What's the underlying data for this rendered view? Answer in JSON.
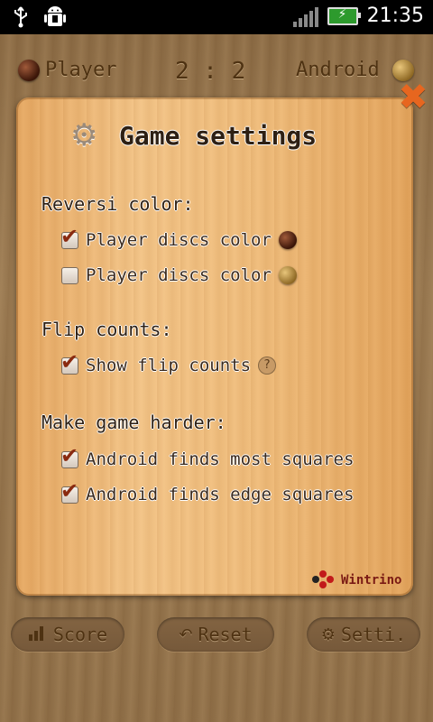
{
  "status_bar": {
    "time": "21:35",
    "usb_icon": "usb-icon",
    "android_icon": "android-debug-icon",
    "signal_icon": "signal-icon",
    "battery_icon": "battery-charging-icon"
  },
  "header": {
    "player_label": "Player",
    "score": "2 : 2",
    "android_label": "Android"
  },
  "settings": {
    "title": "Game settings",
    "sections": {
      "reversi_color": {
        "title": "Reversi color:",
        "options": [
          {
            "label": "Player discs color",
            "checked": true
          },
          {
            "label": "Player discs color",
            "checked": false
          }
        ]
      },
      "flip_counts": {
        "title": "Flip counts:",
        "options": [
          {
            "label": "Show flip counts",
            "checked": true
          }
        ]
      },
      "harder": {
        "title": "Make game harder:",
        "options": [
          {
            "label": "Android finds most squares",
            "checked": true
          },
          {
            "label": "Android finds edge squares",
            "checked": true
          }
        ]
      }
    },
    "brand": "Wintrino"
  },
  "toolbar": {
    "score_label": "Score",
    "reset_label": "Reset",
    "settings_label": "Setti."
  },
  "colors": {
    "accent_close": "#e7661f",
    "dark_disc": "#3a1508",
    "light_disc": "#e8c57a"
  }
}
